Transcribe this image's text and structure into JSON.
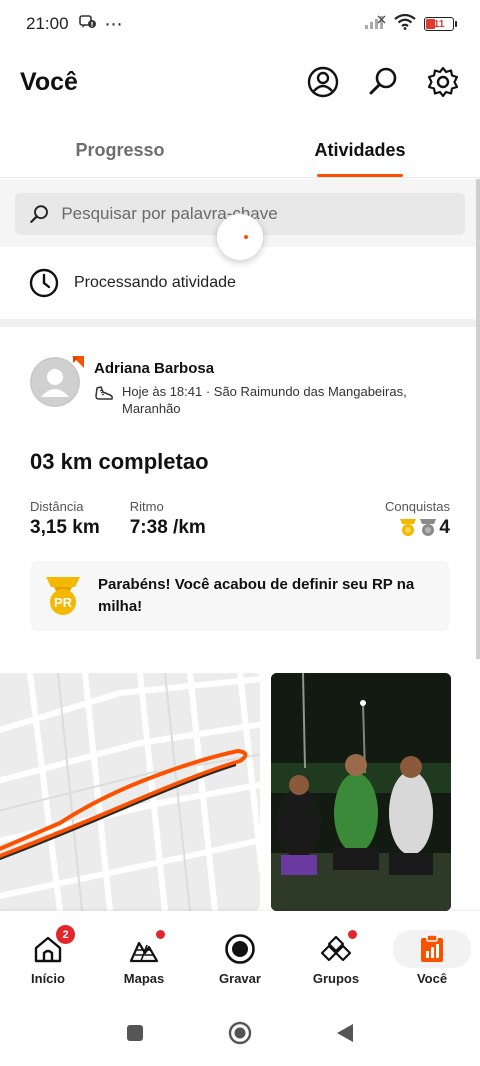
{
  "status_bar": {
    "time": "21:00",
    "battery_level": "11",
    "battery_color": "#e03a2f"
  },
  "header": {
    "title": "Você",
    "icons": [
      "profile-icon",
      "search-icon",
      "settings-icon"
    ]
  },
  "tabs": [
    {
      "label": "Progresso",
      "active": false
    },
    {
      "label": "Atividades",
      "active": true
    }
  ],
  "search": {
    "placeholder": "Pesquisar por palavra-chave"
  },
  "processing": {
    "label": "Processando atividade"
  },
  "activity": {
    "athlete_name": "Adriana Barbosa",
    "meta_line1": "Hoje às 18:41 · São Raimundo das Mangabeiras,",
    "meta_line2": "Maranhão",
    "title": "03 km completao",
    "stats": [
      {
        "label": "Distância",
        "value": "3,15 km"
      },
      {
        "label": "Ritmo",
        "value": "7:38 /km"
      }
    ],
    "achievements": {
      "label": "Conquistas",
      "count": "4"
    },
    "pr_banner": {
      "badge": "PR",
      "line1": "Parabéns! Você acabou de definir seu RP na",
      "line2": "milha!"
    }
  },
  "bottom_nav": [
    {
      "label": "Início",
      "icon": "home-icon",
      "badge": "2"
    },
    {
      "label": "Mapas",
      "icon": "maps-icon",
      "dot": true
    },
    {
      "label": "Gravar",
      "icon": "record-icon"
    },
    {
      "label": "Grupos",
      "icon": "groups-icon",
      "dot": true
    },
    {
      "label": "Você",
      "icon": "you-icon",
      "active": true
    }
  ],
  "colors": {
    "accent": "#fc5200",
    "badge_red": "#e4262c",
    "gold": "#f5b800"
  }
}
